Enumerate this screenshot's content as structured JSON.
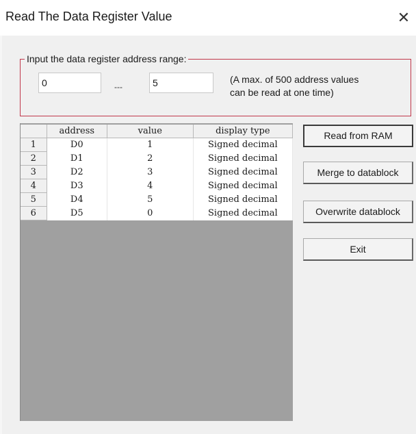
{
  "window": {
    "title": "Read The Data Register Value",
    "close_glyph": "✕"
  },
  "range": {
    "legend": "Input the data register address range:",
    "from_value": "0",
    "separator": "---",
    "to_value": "5",
    "hint_line1": "(A max. of 500 address values",
    "hint_line2": "can be read at one time)"
  },
  "table": {
    "columns": [
      "",
      "address",
      "value",
      "display type"
    ],
    "rows": [
      {
        "num": "1",
        "address": "D0",
        "value": "1",
        "type": "Signed decimal"
      },
      {
        "num": "2",
        "address": "D1",
        "value": "2",
        "type": "Signed decimal"
      },
      {
        "num": "3",
        "address": "D2",
        "value": "3",
        "type": "Signed decimal"
      },
      {
        "num": "4",
        "address": "D3",
        "value": "4",
        "type": "Signed decimal"
      },
      {
        "num": "5",
        "address": "D4",
        "value": "5",
        "type": "Signed decimal"
      },
      {
        "num": "6",
        "address": "D5",
        "value": "0",
        "type": "Signed decimal"
      }
    ]
  },
  "buttons": {
    "read": "Read from RAM",
    "merge": "Merge to datablock",
    "overwrite": "Overwrite datablock",
    "exit": "Exit"
  },
  "colors": {
    "groupbox_border": "#c0364a",
    "grid_background": "#a0a0a0",
    "dialog_background": "#f0f0f0"
  }
}
